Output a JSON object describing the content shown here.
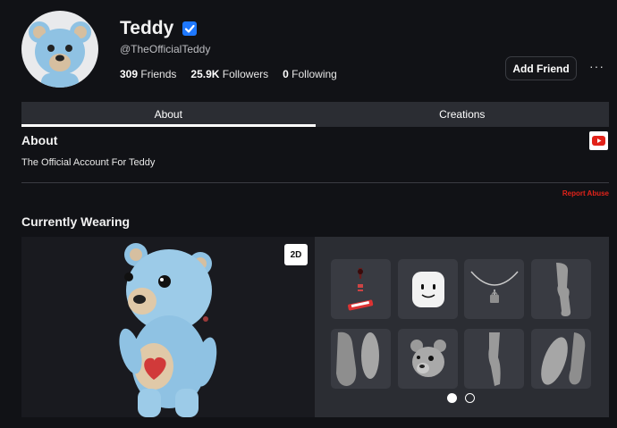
{
  "profile": {
    "display_name": "Teddy",
    "username": "@TheOfficialTeddy",
    "verified_icon": "verified-badge-icon",
    "avatar_icon": "teddy-bear-avatar"
  },
  "stats": {
    "friends_count": "309",
    "friends_label": "Friends",
    "followers_count": "25.9K",
    "followers_label": "Followers",
    "following_count": "0",
    "following_label": "Following"
  },
  "actions": {
    "add_friend_label": "Add Friend",
    "more_label": "···"
  },
  "tabs": [
    {
      "label": "About",
      "active": true
    },
    {
      "label": "Creations",
      "active": false
    }
  ],
  "about": {
    "title": "About",
    "bio": "The Official Account For Teddy",
    "social_icon": "youtube-icon",
    "report_label": "Report Abuse"
  },
  "wearing": {
    "title": "Currently Wearing",
    "view_toggle_label": "2D",
    "items": [
      {
        "icon": "accessory-icon"
      },
      {
        "icon": "smile-face-icon"
      },
      {
        "icon": "necklace-icon"
      },
      {
        "icon": "left-leg-icon"
      },
      {
        "icon": "right-arm-icon"
      },
      {
        "icon": "bear-head-icon"
      },
      {
        "icon": "torso-icon"
      },
      {
        "icon": "left-arm-icon"
      }
    ],
    "page_count": 2,
    "current_page": 1
  },
  "colors": {
    "background": "#111216",
    "accent": "#1e78ff",
    "report": "#e2231a",
    "bear": "#8fc2e3"
  }
}
